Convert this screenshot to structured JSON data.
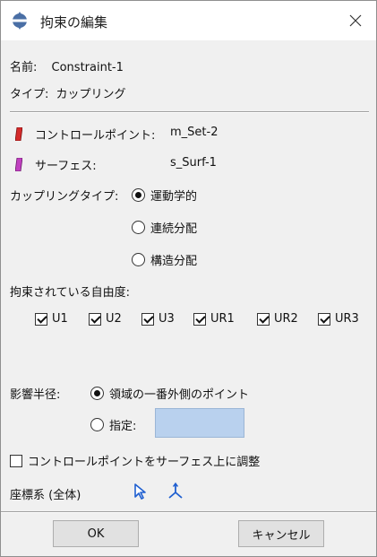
{
  "window": {
    "title": "拘束の編集"
  },
  "name": {
    "label": "名前:",
    "value": "Constraint-1"
  },
  "type": {
    "label": "タイプ:",
    "value": "カップリング"
  },
  "control_point": {
    "label": "コントロールポイント:",
    "value": "m_Set-2",
    "color": "#d42a2a"
  },
  "surface": {
    "label": "サーフェス:",
    "value": "s_Surf-1",
    "color": "#c040c0"
  },
  "coupling_type": {
    "label": "カップリングタイプ:",
    "options": [
      {
        "label": "運動学的",
        "selected": true
      },
      {
        "label": "連続分配",
        "selected": false
      },
      {
        "label": "構造分配",
        "selected": false
      }
    ]
  },
  "dof": {
    "label": "拘束されている自由度:",
    "items": [
      {
        "label": "U1",
        "checked": true
      },
      {
        "label": "U2",
        "checked": true
      },
      {
        "label": "U3",
        "checked": true
      },
      {
        "label": "UR1",
        "checked": true
      },
      {
        "label": "UR2",
        "checked": true
      },
      {
        "label": "UR3",
        "checked": true
      }
    ]
  },
  "influence_radius": {
    "label": "影響半径:",
    "options": [
      {
        "label": "領域の一番外側のポイント",
        "selected": true
      },
      {
        "label": "指定:",
        "selected": false
      }
    ],
    "specified_value": ""
  },
  "adjust": {
    "label": "コントロールポイントをサーフェス上に調整",
    "checked": false
  },
  "csys": {
    "label": "座標系 (全体)",
    "icons": [
      "select-arrow-icon",
      "csys-axes-icon"
    ],
    "icon_color": "#1f5fd0"
  },
  "buttons": {
    "ok": "OK",
    "cancel": "キャンセル"
  }
}
